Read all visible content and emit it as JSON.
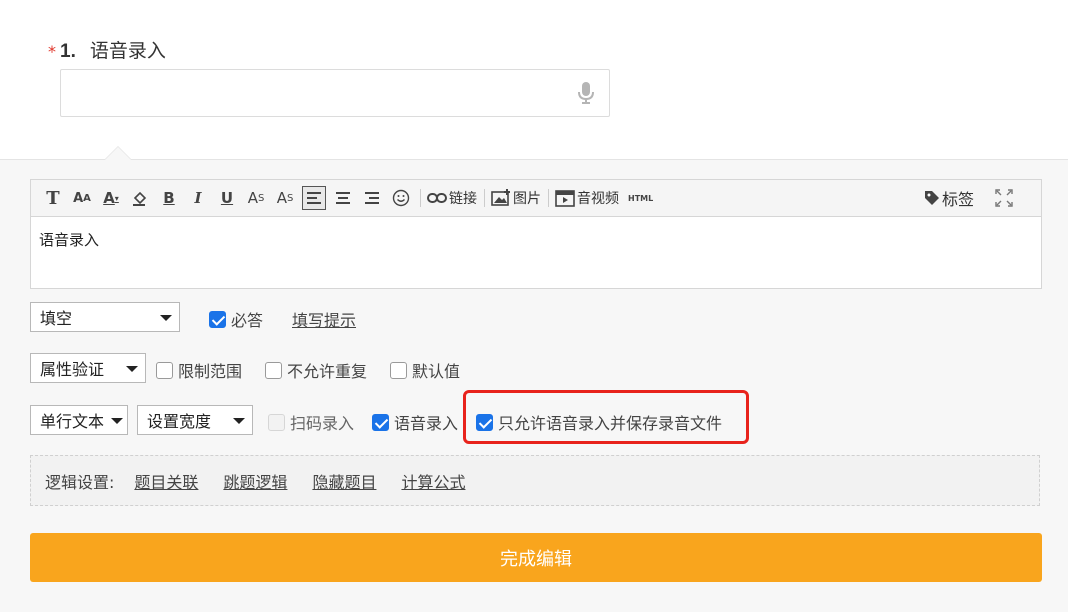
{
  "question": {
    "required_mark": "*",
    "number": "1.",
    "title": "语音录入"
  },
  "toolbar": {
    "link_label": "链接",
    "image_label": "图片",
    "media_label": "音视频",
    "html_label": "HTML",
    "tag_label": "标签"
  },
  "editor": {
    "content": "语音录入"
  },
  "row1": {
    "type_select": "填空",
    "required_label": "必答",
    "hint_link": "填写提示"
  },
  "row2": {
    "validate_select": "属性验证",
    "limit_label": "限制范围",
    "no_repeat_label": "不允许重复",
    "default_label": "默认值"
  },
  "row3": {
    "text_select": "单行文本",
    "width_select": "设置宽度",
    "scan_label": "扫码录入",
    "voice_label": "语音录入",
    "voice_only_label": "只允许语音录入并保存录音文件"
  },
  "logic": {
    "label": "逻辑设置:",
    "links": [
      "题目关联",
      "跳题逻辑",
      "隐藏题目",
      "计算公式"
    ]
  },
  "done_button": "完成编辑",
  "colors": {
    "accent": "#f9a51d",
    "checkbox": "#1a73e8",
    "highlight": "#e8231c",
    "required": "#e0362b"
  }
}
